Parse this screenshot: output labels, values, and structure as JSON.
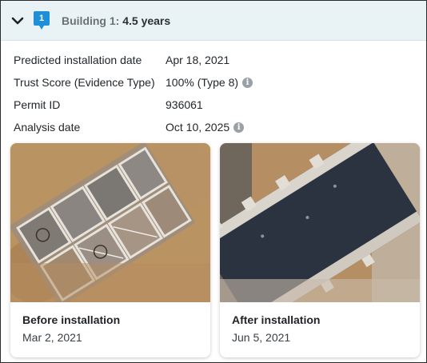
{
  "header": {
    "badge_number": "1",
    "building_label": "Building 1:",
    "building_value": "4.5 years"
  },
  "details": [
    {
      "label": "Predicted installation date",
      "value": "Apr 18, 2021",
      "info": false
    },
    {
      "label": "Trust Score (Evidence Type)",
      "value": "100% (Type 8)",
      "info": true
    },
    {
      "label": "Permit ID",
      "value": "936061",
      "info": false
    },
    {
      "label": "Analysis date",
      "value": "Oct 10, 2025",
      "info": true
    }
  ],
  "cards": [
    {
      "title": "Before installation",
      "date": "Mar 2, 2021"
    },
    {
      "title": "After installation",
      "date": "Jun 5, 2021"
    }
  ],
  "colors": {
    "header_bg": "#e9f3f5",
    "badge_blue": "#1f8fd9",
    "info_gray": "#9aa1a6"
  }
}
